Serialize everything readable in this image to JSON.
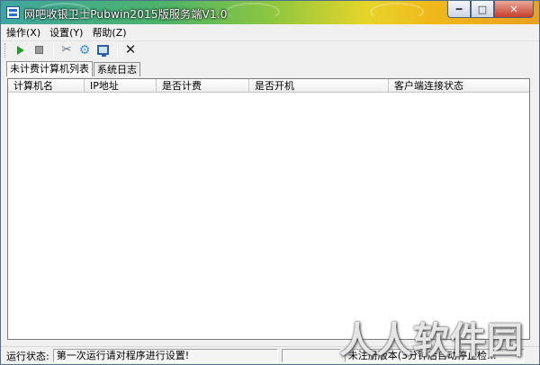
{
  "window": {
    "title": "网吧收银卫士Pubwin2015版服务端V1.0",
    "controls": {
      "minimize": "━",
      "maximize": "□",
      "close": "✕"
    }
  },
  "menu": {
    "items": [
      {
        "label": "操作(X)"
      },
      {
        "label": "设置(Y)"
      },
      {
        "label": "帮助(Z)"
      }
    ]
  },
  "toolbar": {
    "buttons": [
      {
        "icon": "play-icon"
      },
      {
        "icon": "stop-icon"
      },
      {
        "icon": "tools-icon"
      },
      {
        "icon": "gear-icon"
      },
      {
        "icon": "monitor-icon"
      },
      {
        "icon": "close-icon"
      }
    ]
  },
  "tabs": [
    {
      "label": "未计费计算机列表",
      "active": true
    },
    {
      "label": "系统日志",
      "active": false
    }
  ],
  "table": {
    "columns": [
      "计算机名",
      "IP地址",
      "是否计费",
      "是否开机",
      "客户端连接状态"
    ],
    "rows": []
  },
  "status": {
    "label": "运行状态:",
    "message": "第一次运行请对程序进行设置!",
    "right_text": "未注册版本(3分钟后自动停止检..."
  },
  "watermark": "人人软件园",
  "colors": {
    "accent_play": "#2a9a2a",
    "close_button": "#c7402a"
  }
}
